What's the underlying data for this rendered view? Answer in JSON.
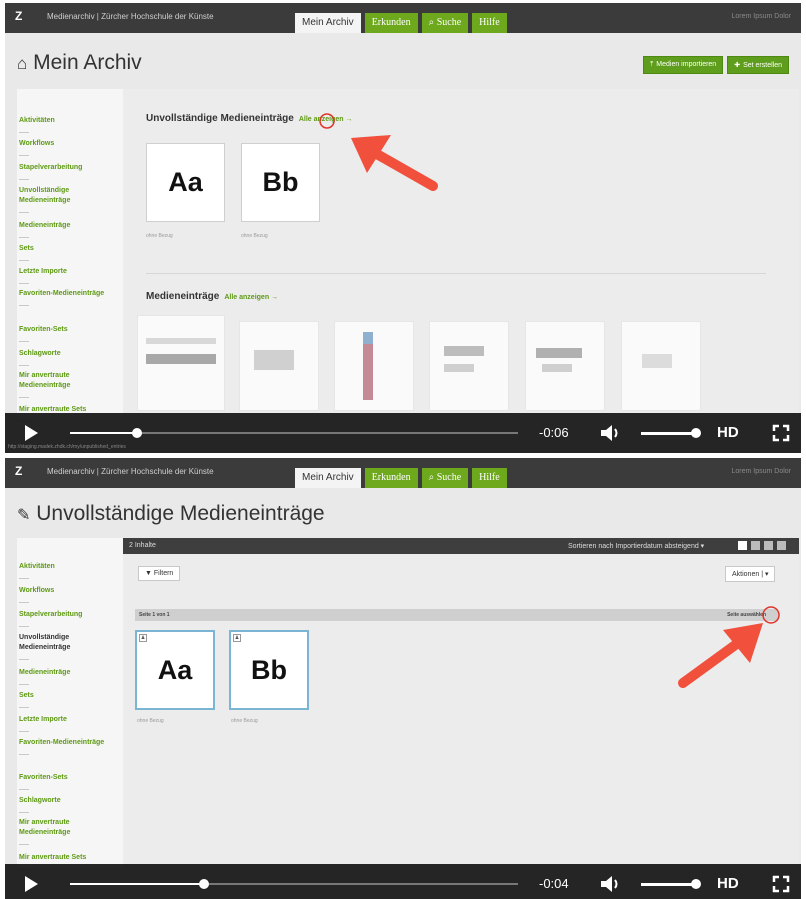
{
  "header": {
    "logo": "Z",
    "site_name": "Medienarchiv | Zürcher Hochschule der Künste",
    "tabs": [
      {
        "label": "Mein Archiv",
        "active": true
      },
      {
        "label": "Erkunden",
        "active": false
      },
      {
        "label": "Suche",
        "active": false
      },
      {
        "label": "Hilfe",
        "active": false
      }
    ],
    "user": "Lorem Ipsum Dolor"
  },
  "frame1": {
    "title": "Mein Archiv",
    "buttons": {
      "import": "Medien importieren",
      "create_set": "Set erstellen"
    },
    "sidebar": [
      "Aktivitäten",
      "Workflows",
      "Stapelverarbeitung",
      "Unvollständige Medieneinträge",
      "Medieneinträge",
      "Sets",
      "Letzte Importe",
      "Favoriten-Medieneinträge",
      "Favoriten-Sets",
      "Schlagworte",
      "Mir anvertraute Medieneinträge",
      "Mir anvertraute Sets"
    ],
    "section1": {
      "title": "Unvollständige Medieneinträge",
      "link": "Alle anzeigen →"
    },
    "cards": [
      {
        "label": "Aa",
        "caption": "ohne Bezug"
      },
      {
        "label": "Bb",
        "caption": "ohne Bezug"
      }
    ],
    "section2": {
      "title": "Medieneinträge",
      "link": "Alle anzeigen →"
    },
    "player": {
      "time": "-0:06",
      "hd": "HD",
      "progress": 0.15
    },
    "status_url": "http://staging.madek.zhdk.ch/my/unpublished_entries"
  },
  "frame2": {
    "title": "Unvollständige Medieneinträge",
    "sidebar_active": "Unvollständige Medieneinträge",
    "count": "2 Inhalte",
    "sort": "Sortieren nach Importierdatum absteigend ▾",
    "filter": "Filtern",
    "actions": "Aktionen",
    "page": "Seite 1 von 1",
    "select_page": "Seite auswählen",
    "cards": [
      {
        "label": "Aa",
        "caption": "ohne Bezug"
      },
      {
        "label": "Bb",
        "caption": "ohne Bezug"
      }
    ],
    "player": {
      "time": "-0:04",
      "hd": "HD",
      "progress": 0.3
    }
  },
  "colors": {
    "accent": "#6ea81d",
    "dark": "#3b3b3b",
    "arrow": "#f0503c"
  }
}
